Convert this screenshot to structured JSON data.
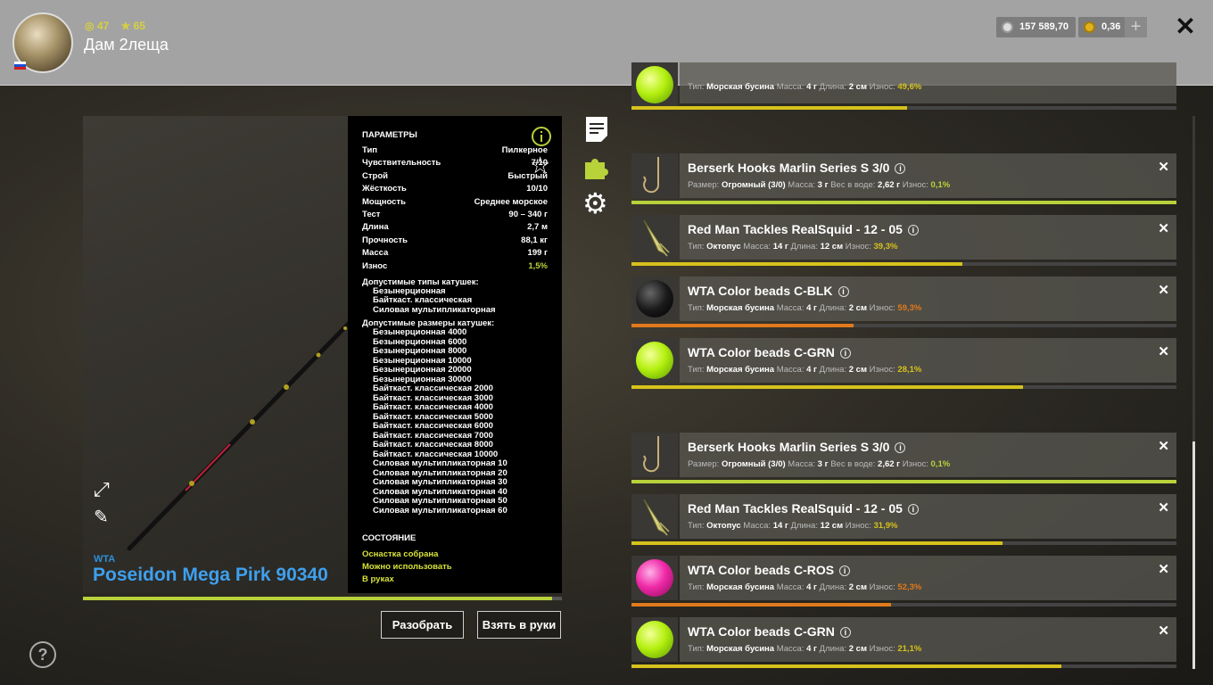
{
  "header": {
    "rank": "47",
    "stars": "65",
    "player_name": "Дам 2леща",
    "silver": "157 589,70",
    "gold": "0,36",
    "plus": "+",
    "close": "✕"
  },
  "rod": {
    "brand": "WTA",
    "name": "Poseidon Mega Pirk 90340",
    "condition_fraction": 0.98
  },
  "params": {
    "heading": "ПАРАМЕТРЫ",
    "rows": [
      {
        "label": "Тип",
        "value": "Пилкерное"
      },
      {
        "label": "Чувствительность",
        "value": "7/10"
      },
      {
        "label": "Строй",
        "value": "Быстрый"
      },
      {
        "label": "Жёсткость",
        "value": "10/10"
      },
      {
        "label": "Мощность",
        "value": "Среднее морское"
      },
      {
        "label": "Тест",
        "value": "90 – 340 г"
      },
      {
        "label": "Длина",
        "value": "2,7 м"
      },
      {
        "label": "Прочность",
        "value": "88,1 кг"
      },
      {
        "label": "Масса",
        "value": "199 г"
      },
      {
        "label": "Износ",
        "value": "1,5%"
      }
    ],
    "reel_types_heading": "Допустимые типы катушек:",
    "reel_types": [
      "Безынерционная",
      "Байткаст. классическая",
      "Силовая мультипликаторная"
    ],
    "reel_sizes_heading": "Допустимые размеры катушек:",
    "reel_sizes": [
      "Безынерционная 4000",
      "Безынерционная 6000",
      "Безынерционная 8000",
      "Безынерционная 10000",
      "Безынерционная 20000",
      "Безынерционная 30000",
      "Байткаст. классическая 2000",
      "Байткаст. классическая 3000",
      "Байткаст. классическая 4000",
      "Байткаст. классическая 5000",
      "Байткаст. классическая 6000",
      "Байткаст. классическая 7000",
      "Байткаст. классическая 8000",
      "Байткаст. классическая 10000",
      "Силовая мультипликаторная 10",
      "Силовая мультипликаторная 20",
      "Силовая мультипликаторная 30",
      "Силовая мультипликаторная 40",
      "Силовая мультипликаторная 50",
      "Силовая мультипликаторная 60"
    ],
    "state_heading": "СОСТОЯНИЕ",
    "state_lines": [
      "Оснастка собрана",
      "Можно использовать",
      "В руках"
    ]
  },
  "buttons": {
    "disassemble": "Разобрать",
    "take": "Взять в руки"
  },
  "items": [
    {
      "kind": "ball-green",
      "title": "",
      "meta": [
        {
          "k": "Тип:",
          "v": "Морская бусина"
        },
        {
          "k": "Масса:",
          "v": "4 г"
        },
        {
          "k": "Длина:",
          "v": "2 см"
        }
      ],
      "wear_label": "Износ:",
      "wear": "49,6%",
      "wear_fraction": 0.505,
      "wear_color": "#d6c21c"
    },
    {
      "kind": "hook",
      "title": "Berserk Hooks Marlin Series S 3/0",
      "meta": [
        {
          "k": "Размер:",
          "v": "Огромный (3/0)"
        },
        {
          "k": "Масса:",
          "v": "3 г"
        },
        {
          "k": "Вес в воде:",
          "v": "2,62 г"
        }
      ],
      "wear_label": "Износ:",
      "wear": "0,1%",
      "wear_fraction": 1.0,
      "wear_color": "#b8d23a"
    },
    {
      "kind": "squid",
      "title": "Red Man Tackles RealSquid - 12 - 05",
      "meta": [
        {
          "k": "Тип:",
          "v": "Октопус"
        },
        {
          "k": "Масса:",
          "v": "14 г"
        },
        {
          "k": "Длина:",
          "v": "12 см"
        }
      ],
      "wear_label": "Износ:",
      "wear": "39,3%",
      "wear_fraction": 0.607,
      "wear_color": "#d6c21c"
    },
    {
      "kind": "ball-black",
      "title": "WTA Color beads C-BLK",
      "meta": [
        {
          "k": "Тип:",
          "v": "Морская бусина"
        },
        {
          "k": "Масса:",
          "v": "4 г"
        },
        {
          "k": "Длина:",
          "v": "2 см"
        }
      ],
      "wear_label": "Износ:",
      "wear": "59,3%",
      "wear_fraction": 0.407,
      "wear_color": "#e07a1c"
    },
    {
      "kind": "ball-green",
      "title": "WTA Color beads C-GRN",
      "meta": [
        {
          "k": "Тип:",
          "v": "Морская бусина"
        },
        {
          "k": "Масса:",
          "v": "4 г"
        },
        {
          "k": "Длина:",
          "v": "2 см"
        }
      ],
      "wear_label": "Износ:",
      "wear": "28,1%",
      "wear_fraction": 0.719,
      "wear_color": "#d6c21c"
    },
    {
      "kind": "hook",
      "title": "Berserk Hooks Marlin Series S 3/0",
      "meta": [
        {
          "k": "Размер:",
          "v": "Огромный (3/0)"
        },
        {
          "k": "Масса:",
          "v": "3 г"
        },
        {
          "k": "Вес в воде:",
          "v": "2,62 г"
        }
      ],
      "wear_label": "Износ:",
      "wear": "0,1%",
      "wear_fraction": 1.0,
      "wear_color": "#b8d23a"
    },
    {
      "kind": "squid",
      "title": "Red Man Tackles RealSquid - 12 - 05",
      "meta": [
        {
          "k": "Тип:",
          "v": "Октопус"
        },
        {
          "k": "Масса:",
          "v": "14 г"
        },
        {
          "k": "Длина:",
          "v": "12 см"
        }
      ],
      "wear_label": "Износ:",
      "wear": "31,9%",
      "wear_fraction": 0.681,
      "wear_color": "#d6c21c"
    },
    {
      "kind": "ball-pink",
      "title": "WTA Color beads C-ROS",
      "meta": [
        {
          "k": "Тип:",
          "v": "Морская бусина"
        },
        {
          "k": "Масса:",
          "v": "4 г"
        },
        {
          "k": "Длина:",
          "v": "2 см"
        }
      ],
      "wear_label": "Износ:",
      "wear": "52,3%",
      "wear_fraction": 0.477,
      "wear_color": "#e07a1c"
    },
    {
      "kind": "ball-green",
      "title": "WTA Color beads C-GRN",
      "meta": [
        {
          "k": "Тип:",
          "v": "Морская бусина"
        },
        {
          "k": "Масса:",
          "v": "4 г"
        },
        {
          "k": "Длина:",
          "v": "2 см"
        }
      ],
      "wear_label": "Износ:",
      "wear": "21,1%",
      "wear_fraction": 0.789,
      "wear_color": "#d6c21c"
    }
  ],
  "help": "?"
}
